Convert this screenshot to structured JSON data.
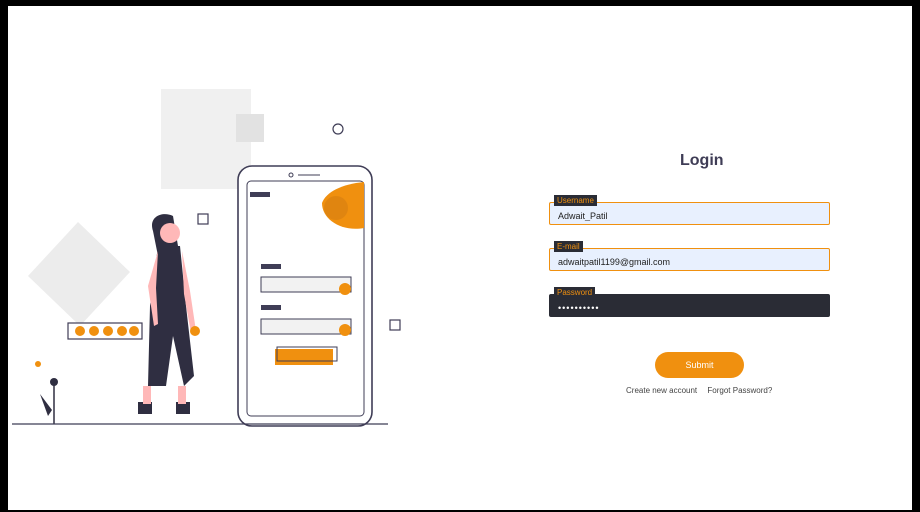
{
  "login": {
    "title": "Login",
    "username_label": "Username",
    "username_value": "Adwait_Patil",
    "email_label": "E-mail",
    "email_value": "adwaitpatil1199@gmail.com",
    "password_label": "Password",
    "password_value": "••••••••••",
    "submit_label": "Submit",
    "create_account_link": "Create new account",
    "forgot_password_link": "Forgot Password?"
  },
  "colors": {
    "accent": "#f0900f",
    "dark": "#2a2c35",
    "field_bg": "#e8f0fe"
  },
  "icons": [
    "phone-illustration",
    "woman-illustration",
    "plant-illustration"
  ]
}
